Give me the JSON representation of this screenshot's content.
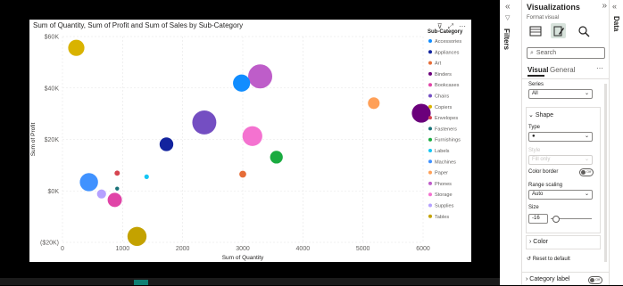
{
  "chart_data": {
    "type": "scatter",
    "title": "Sum of Quantity, Sum of Profit and Sum of Sales by Sub-Category",
    "xlabel": "Sum of Quantity",
    "ylabel": "Sum of Profit",
    "xlim": [
      0,
      6000
    ],
    "ylim": [
      -20000,
      60000
    ],
    "x_ticks": [
      0,
      1000,
      2000,
      3000,
      4000,
      5000,
      6000
    ],
    "x_tick_labels": [
      "0",
      "1000",
      "2000",
      "3000",
      "4000",
      "5000",
      "6000"
    ],
    "y_ticks": [
      60000,
      40000,
      20000,
      0,
      -20000
    ],
    "y_tick_labels": [
      "$60K",
      "$40K",
      "$20K",
      "$0K",
      "($20K)"
    ],
    "grid": true,
    "legend_title": "Sub-Category",
    "legend_position": "right",
    "points": [
      {
        "name": "Accessories",
        "color": "#118DFF",
        "x": 2980,
        "y": 41900,
        "size": 167000
      },
      {
        "name": "Appliances",
        "color": "#12239E",
        "x": 1730,
        "y": 18100,
        "size": 107000
      },
      {
        "name": "Art",
        "color": "#E66C37",
        "x": 3000,
        "y": 6500,
        "size": 27000
      },
      {
        "name": "Binders",
        "color": "#6B007B",
        "x": 5970,
        "y": 30200,
        "size": 203000
      },
      {
        "name": "Bookcases",
        "color": "#E044A7",
        "x": 870,
        "y": -3500,
        "size": 115000
      },
      {
        "name": "Chairs",
        "color": "#744EC2",
        "x": 2360,
        "y": 26600,
        "size": 328000
      },
      {
        "name": "Copiers",
        "color": "#D9B300",
        "x": 230,
        "y": 55600,
        "size": 150000
      },
      {
        "name": "Envelopes",
        "color": "#D64550",
        "x": 910,
        "y": 6900,
        "size": 16000
      },
      {
        "name": "Fasteners",
        "color": "#197278",
        "x": 910,
        "y": 900,
        "size": 3000
      },
      {
        "name": "Furnishings",
        "color": "#1AAB40",
        "x": 3560,
        "y": 13100,
        "size": 92000
      },
      {
        "name": "Labels",
        "color": "#15C6F4",
        "x": 1400,
        "y": 5500,
        "size": 12000
      },
      {
        "name": "Machines",
        "color": "#4092FF",
        "x": 440,
        "y": 3400,
        "size": 189000
      },
      {
        "name": "Paper",
        "color": "#FFA058",
        "x": 5180,
        "y": 34100,
        "size": 78000
      },
      {
        "name": "Phones",
        "color": "#BE5DC9",
        "x": 3290,
        "y": 44500,
        "size": 330000
      },
      {
        "name": "Storage",
        "color": "#F472D0",
        "x": 3160,
        "y": 21300,
        "size": 224000
      },
      {
        "name": "Supplies",
        "color": "#B5A1FF",
        "x": 650,
        "y": -1200,
        "size": 47000
      },
      {
        "name": "Tables",
        "color": "#C4A200",
        "x": 1240,
        "y": -17700,
        "size": 207000
      }
    ]
  },
  "visual_header": {
    "filter_icon": "filter-icon",
    "focus_icon": "focus-mode-icon",
    "more_icon": "more-options-icon"
  },
  "filters_pane": {
    "label": "Filters",
    "collapse": "«"
  },
  "viz_pane": {
    "title": "Visualizations",
    "collapse": "»",
    "format_label": "Format visual",
    "search_placeholder": "Search",
    "tabs": {
      "visual": "Visual",
      "general": "General",
      "more": "⋯"
    },
    "series": {
      "label": "Series",
      "value": "All"
    },
    "shape": {
      "header": "Shape",
      "type_label": "Type",
      "type_value": "●",
      "style_label": "Style",
      "style_value": "Fill only",
      "color_border_label": "Color border",
      "color_border_state": "Off",
      "range_scaling_label": "Range scaling",
      "range_scaling_value": "Auto",
      "size_label": "Size",
      "size_value": "-16"
    },
    "color_header": "Color",
    "reset_label": "Reset to default",
    "category_label": "Category label",
    "category_label_state": "Off"
  },
  "data_pane": {
    "label": "Data",
    "collapse": "«"
  }
}
